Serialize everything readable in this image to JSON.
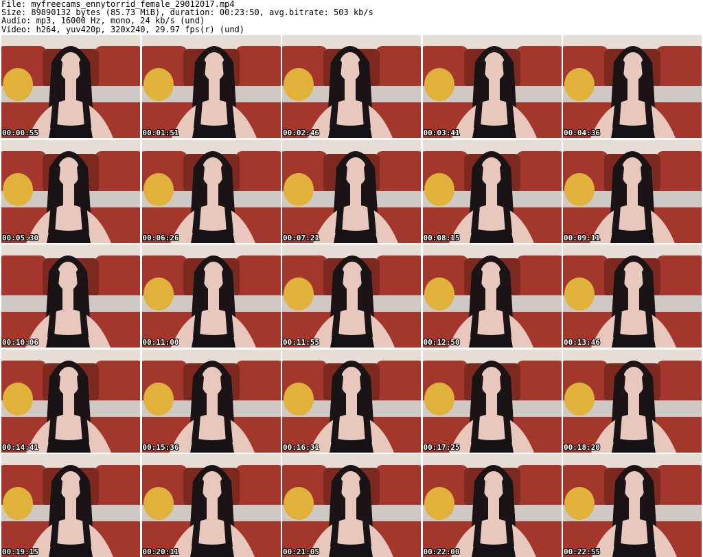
{
  "header": {
    "file": "File: myfreecams_ennytorrid_female_29012017.mp4",
    "size": "Size: 89890132 bytes (85.73 MiB), duration: 00:23:50, avg.bitrate: 503 kb/s",
    "audio": "Audio: mp3, 16000 Hz, mono, 24 kb/s (und)",
    "video": "Video: h264, yuv420p, 320x240, 29.97 fps(r) (und)"
  },
  "colors": {
    "wall": "#e6ddd7",
    "sofa": "#a3372c",
    "sofa_dark": "#7e2920",
    "cushion": "#e0b23a",
    "seat": "#cfc9c5",
    "hair": "#1b1417",
    "skin": "#e8c7bd",
    "top": "#141215"
  },
  "thumbnails": [
    {
      "time": "00:00:55"
    },
    {
      "time": "00:01:51"
    },
    {
      "time": "00:02:46"
    },
    {
      "time": "00:03:41"
    },
    {
      "time": "00:04:36"
    },
    {
      "time": "00:05:30"
    },
    {
      "time": "00:06:26"
    },
    {
      "time": "00:07:21"
    },
    {
      "time": "00:08:15"
    },
    {
      "time": "00:09:11"
    },
    {
      "time": "00:10:06"
    },
    {
      "time": "00:11:00"
    },
    {
      "time": "00:11:55"
    },
    {
      "time": "00:12:50"
    },
    {
      "time": "00:13:46"
    },
    {
      "time": "00:14:41"
    },
    {
      "time": "00:15:36"
    },
    {
      "time": "00:16:31"
    },
    {
      "time": "00:17:25"
    },
    {
      "time": "00:18:20"
    },
    {
      "time": "00:19:15"
    },
    {
      "time": "00:20:11"
    },
    {
      "time": "00:21:05"
    },
    {
      "time": "00:22:00"
    },
    {
      "time": "00:22:55"
    }
  ]
}
